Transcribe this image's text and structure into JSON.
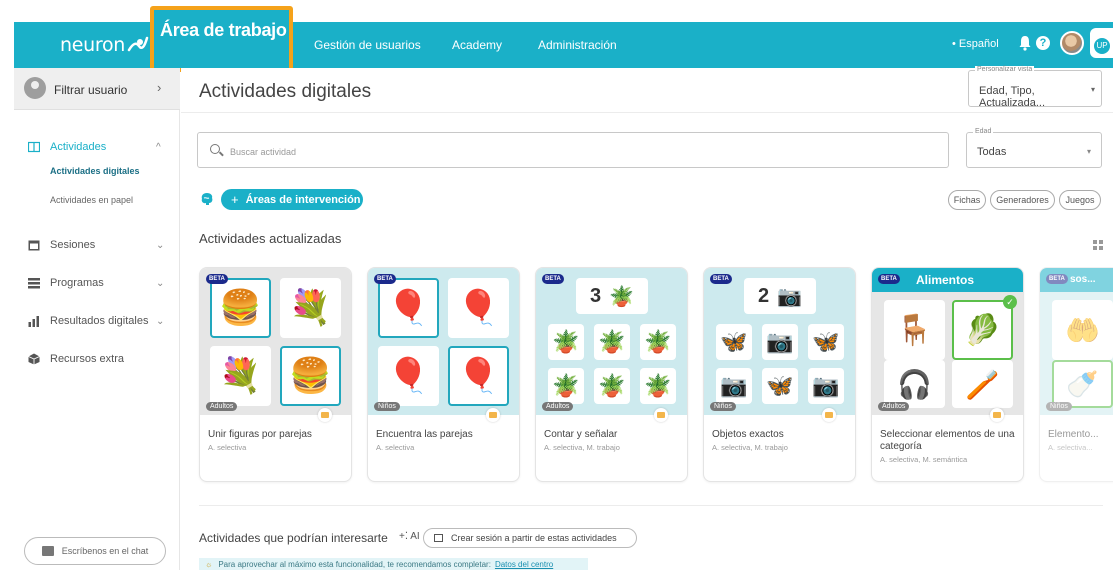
{
  "header": {
    "logo_text": "neuron",
    "nav": [
      {
        "label": "Área de trabajo"
      },
      {
        "label": "Gestión de usuarios"
      },
      {
        "label": "Academy"
      },
      {
        "label": "Administración"
      }
    ],
    "language": "• Español",
    "brand_color": "#1ab0c8",
    "highlight_color": "#f5a21a",
    "up_logo": "UP",
    "help_glyph": "?"
  },
  "sidebar": {
    "filter_user": "Filtrar usuario",
    "items": [
      {
        "label": "Actividades",
        "icon": "activities-icon"
      },
      {
        "label": "Sesiones",
        "icon": "calendar-icon"
      },
      {
        "label": "Programas",
        "icon": "list-icon"
      },
      {
        "label": "Resultados digitales",
        "icon": "bar-chart-icon"
      },
      {
        "label": "Recursos extra",
        "icon": "cube-icon"
      }
    ],
    "sub_items": [
      {
        "label": "Actividades digitales"
      },
      {
        "label": "Actividades en papel"
      }
    ],
    "chat": "Escríbenos en el chat"
  },
  "main": {
    "title": "Actividades digitales",
    "view_select": {
      "label": "Personalizar vista",
      "value": "Edad, Tipo, Actualizada..."
    },
    "search": {
      "placeholder": "Buscar actividad"
    },
    "age_select": {
      "label": "Edad",
      "value": "Todas"
    },
    "areas_button": "Áreas de intervención",
    "chips": [
      "Fichas",
      "Generadores",
      "Juegos"
    ],
    "section_title": "Actividades actualizadas",
    "cards": [
      {
        "title": "Unir figuras por parejas",
        "sub": "A. selectiva",
        "tag": "Adultos",
        "badge": "BETA"
      },
      {
        "title": "Encuentra las parejas",
        "sub": "A. selectiva",
        "tag": "Niños",
        "badge": "BETA"
      },
      {
        "title": "Contar y señalar",
        "sub": "A. selectiva, M. trabajo",
        "tag": "Adultos",
        "badge": "BETA",
        "head": "3"
      },
      {
        "title": "Objetos exactos",
        "sub": "A. selectiva, M. trabajo",
        "tag": "Niños",
        "badge": "BETA",
        "head": "2"
      },
      {
        "title": "Seleccionar elementos de una categoría",
        "sub": "A. selectiva, M. semántica",
        "tag": "Adultos",
        "badge": "BETA",
        "head": "Alimentos"
      },
      {
        "title": "Elemento...",
        "sub": "A. selectiva...",
        "tag": "Niños",
        "badge": "BETA",
        "head": "sos..."
      }
    ],
    "bottom_title": "Actividades que podrían interesarte",
    "ai_label": "+⁚ AI",
    "create_session": "Crear sesión a partir de estas actividades",
    "tip_text": "Para aprovechar al máximo esta funcionalidad, te recomendamos completar:",
    "tip_link": "Datos del centro"
  }
}
